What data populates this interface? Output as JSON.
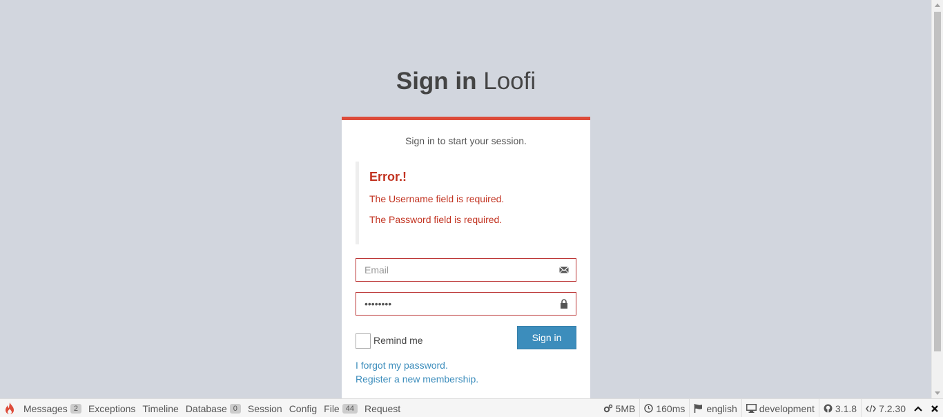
{
  "logo": {
    "bold": "Sign in",
    "light": " Loofi"
  },
  "login": {
    "message": "Sign in to start your session.",
    "error_title": "Error.!",
    "errors": [
      "The Username field is required.",
      "The Password field is required."
    ],
    "email_placeholder": "Email",
    "password_value": "••••••••",
    "remember_label": "Remind me",
    "signin_label": "Sign in",
    "forgot_link": "I forgot my password.",
    "register_link": "Register a new membership."
  },
  "toolbar": {
    "messages": "Messages",
    "messages_count": "2",
    "exceptions": "Exceptions",
    "timeline": "Timeline",
    "database": "Database",
    "database_count": "0",
    "session": "Session",
    "config": "Config",
    "file": "File",
    "file_count": "44",
    "request": "Request",
    "memory": "5MB",
    "time": "160ms",
    "locale": "english",
    "environment": "development",
    "version": "3.1.8",
    "php_version": "7.2.30"
  },
  "colors": {
    "accent": "#dd4b39",
    "primary": "#3c8dbc",
    "background": "#d2d6de"
  }
}
